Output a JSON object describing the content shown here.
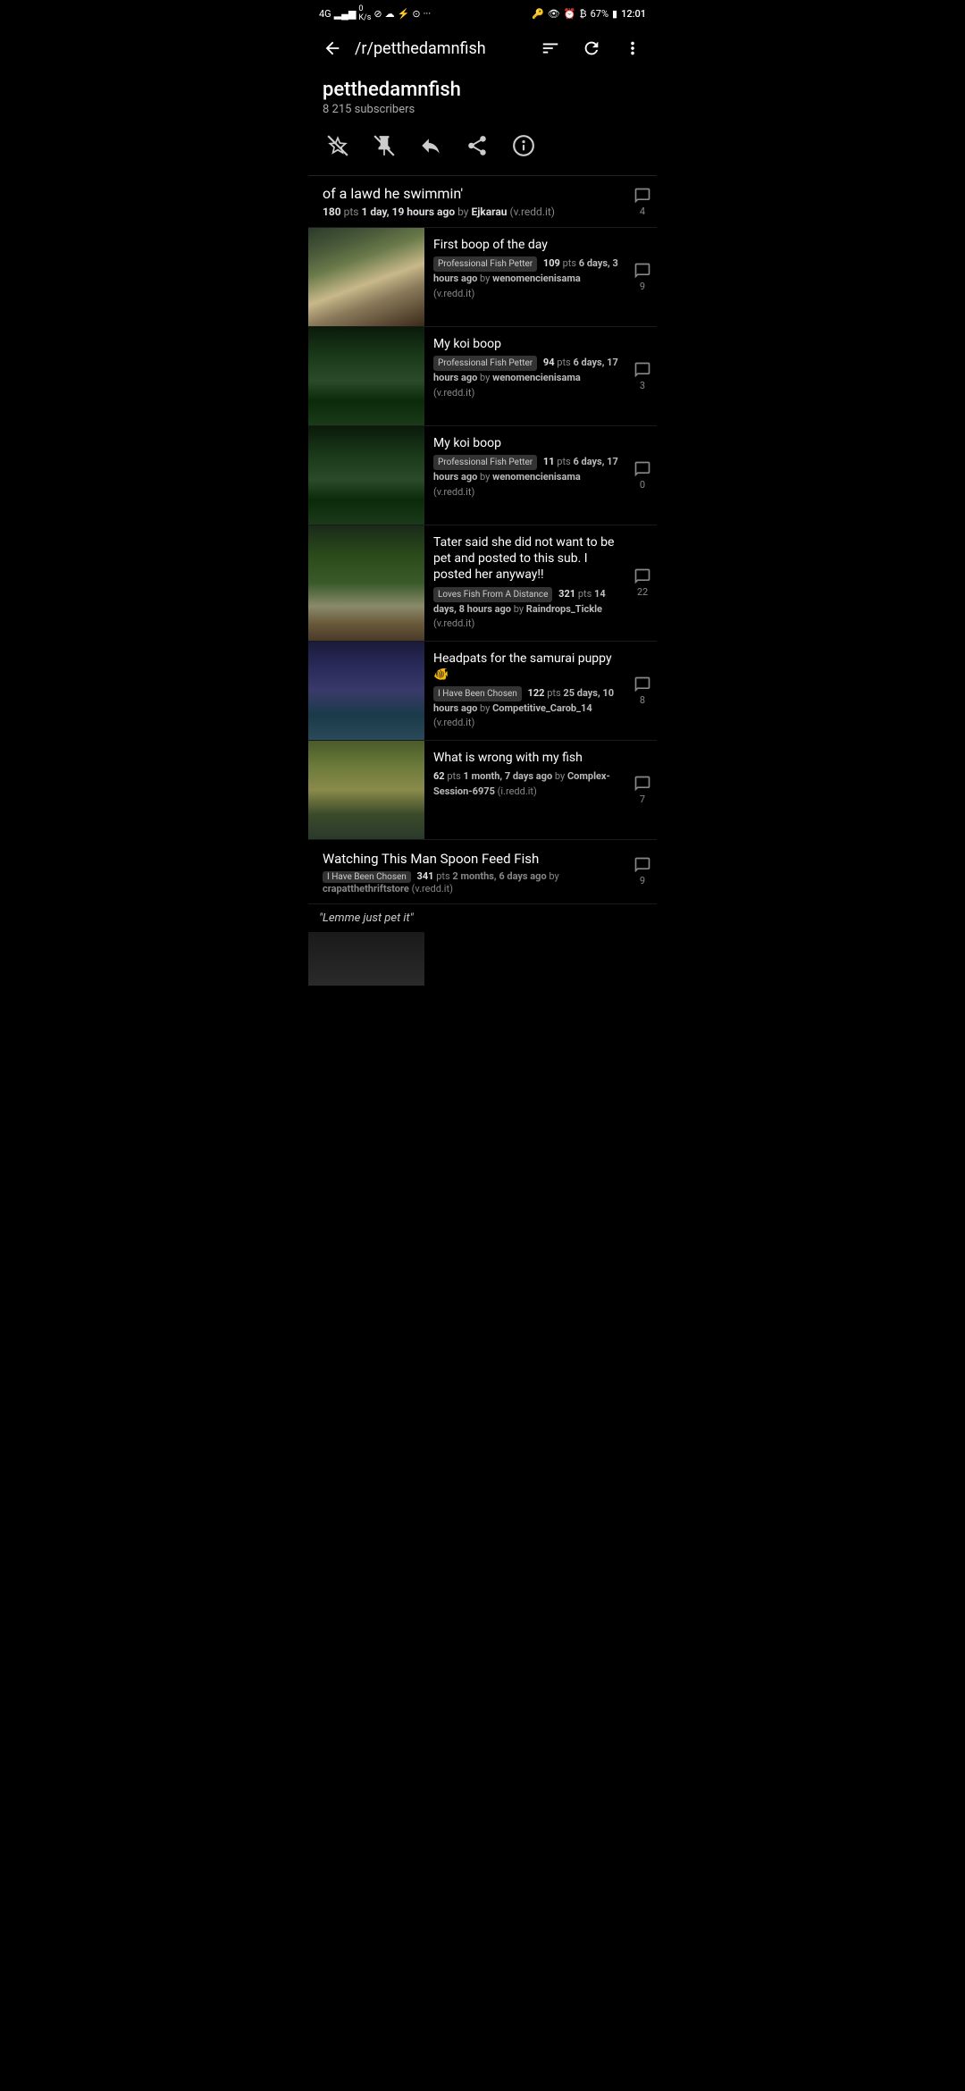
{
  "statusBar": {
    "left": "4G 46 WiFi 0 K/s icons",
    "battery": "67%",
    "time": "12:01"
  },
  "appBar": {
    "backLabel": "←",
    "title": "/r/petthedamnfish",
    "filterIcon": "filter",
    "refreshIcon": "refresh",
    "moreIcon": "more"
  },
  "subreddit": {
    "name": "petthedamnfish",
    "subscribers": "8 215 subscribers"
  },
  "actionBar": {
    "starIcon": "star-off",
    "pinIcon": "pin-off",
    "replyIcon": "reply",
    "shareIcon": "share",
    "infoIcon": "info"
  },
  "featuredPost": {
    "title": "of a lawd he swimmin'",
    "pts": "180",
    "ptsLabel": "pts",
    "age": "1 day, 19 hours ago",
    "by": "by",
    "author": "Ejkarau",
    "source": "(v.redd.it)",
    "comments": "4"
  },
  "posts": [
    {
      "id": 1,
      "title": "First boop of the day",
      "flair": "Professional Fish Petter",
      "pts": "109",
      "age": "6 days, 3 hours ago",
      "author": "wenomencienisama",
      "source": "(v.redd.it)",
      "comments": "9",
      "thumbClass": "thumb-fish1"
    },
    {
      "id": 2,
      "title": "My koi boop",
      "flair": "Professional Fish Petter",
      "pts": "94",
      "age": "6 days, 17 hours ago",
      "author": "wenomencienisama",
      "source": "(v.redd.it)",
      "comments": "3",
      "thumbClass": "thumb-fish2"
    },
    {
      "id": 3,
      "title": "My koi boop",
      "flair": "Professional Fish Petter",
      "pts": "11",
      "age": "6 days, 17 hours ago",
      "author": "wenomencienisama",
      "source": "(v.redd.it)",
      "comments": "0",
      "thumbClass": "thumb-fish3"
    },
    {
      "id": 4,
      "title": "Tater said she did not want to be pet and posted to this sub. I posted her anyway!!",
      "flair": "Loves Fish From A Distance",
      "pts": "321",
      "age": "14 days, 8 hours ago",
      "author": "Raindrops_Tickle",
      "source": "(v.redd.it)",
      "comments": "22",
      "thumbClass": "thumb-fish4"
    },
    {
      "id": 5,
      "title": "Headpats for the samurai puppy 🐠",
      "flair": "I Have Been Chosen",
      "pts": "122",
      "age": "25 days, 10 hours ago",
      "author": "Competitive_Carob_14",
      "source": "(v.redd.it)",
      "comments": "8",
      "thumbClass": "thumb-fish5"
    },
    {
      "id": 6,
      "title": "What is wrong with my fish",
      "flair": "",
      "pts": "62",
      "age": "1 month, 7 days ago",
      "author": "Complex-Session-6975",
      "source": "(i.redd.it)",
      "comments": "7",
      "thumbClass": "thumb-fish6"
    }
  ],
  "bottomPost": {
    "title": "Watching This Man Spoon Feed Fish",
    "flair": "I Have Been Chosen",
    "pts": "341",
    "age": "2 months, 6 days ago",
    "by": "by",
    "author": "crapatthethriftstore",
    "source": "(v.redd.it)",
    "comments": "9"
  },
  "lastCaption": "\"Lemme just pet it\""
}
